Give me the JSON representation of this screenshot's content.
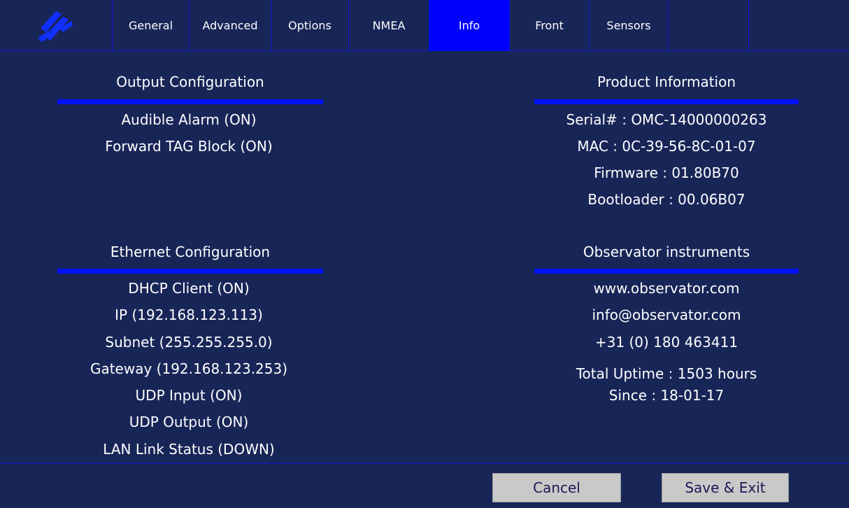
{
  "tabs": [
    {
      "label": "General"
    },
    {
      "label": "Advanced"
    },
    {
      "label": "Options"
    },
    {
      "label": "NMEA"
    },
    {
      "label": "Info",
      "active": true
    },
    {
      "label": "Front"
    },
    {
      "label": "Sensors"
    }
  ],
  "output_config": {
    "title": "Output Configuration",
    "items": [
      "Audible Alarm (ON)",
      "Forward TAG Block (ON)"
    ]
  },
  "ethernet_config": {
    "title": "Ethernet Configuration",
    "items": [
      "DHCP Client (ON)",
      "IP (192.168.123.113)",
      "Subnet (255.255.255.0)",
      "Gateway (192.168.123.253)",
      "UDP Input (ON)",
      "UDP Output (ON)",
      "LAN Link Status (DOWN)"
    ]
  },
  "product_info": {
    "title": "Product Information",
    "items": [
      "Serial# : OMC-14000000263",
      "MAC : 0C-39-56-8C-01-07",
      "Firmware : 01.80B70",
      "Bootloader : 00.06B07"
    ]
  },
  "observator": {
    "title": "Observator instruments",
    "items": [
      "www.observator.com",
      "info@observator.com",
      "+31 (0) 180 463411"
    ],
    "uptime": "Total Uptime : 1503 hours",
    "since": "Since : 18-01-17"
  },
  "buttons": {
    "cancel": "Cancel",
    "save_exit": "Save & Exit"
  },
  "colors": {
    "background": "#182557",
    "active_tab": "#0000ff",
    "accent": "#0010ff",
    "button_bg": "#c9c9c9"
  },
  "icons": {
    "logo": "observator-logo-icon"
  }
}
